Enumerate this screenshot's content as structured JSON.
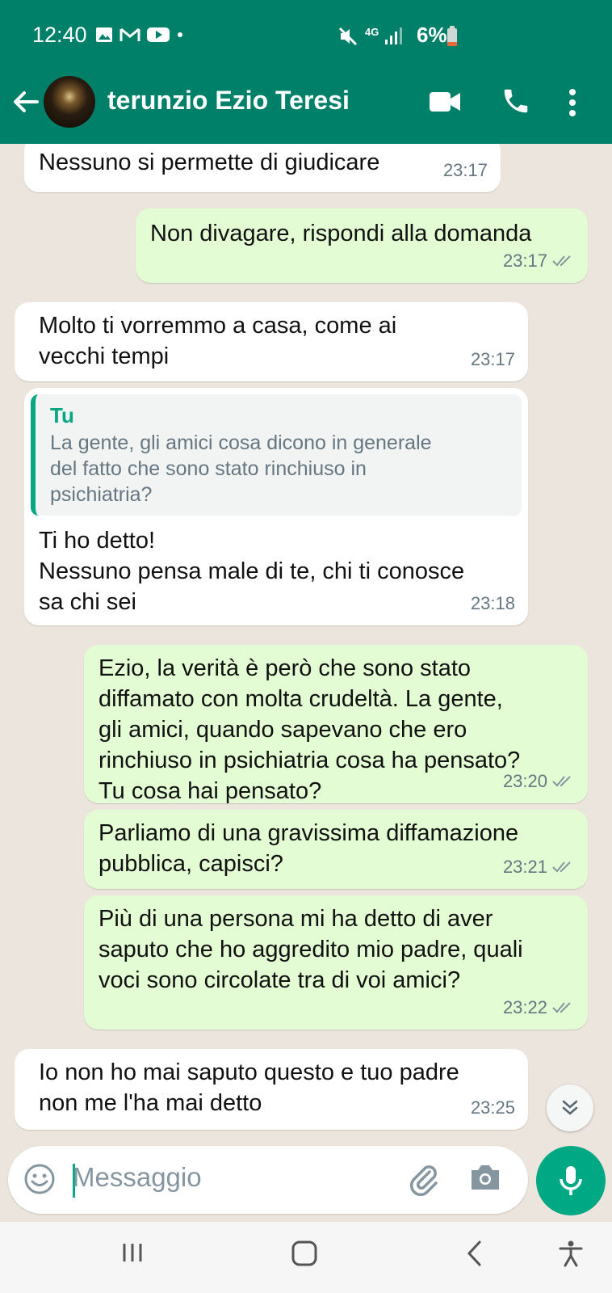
{
  "status": {
    "time": "12:40",
    "network": "4G",
    "battery": "6%"
  },
  "header": {
    "contact_name": "terunzio Ezio Teresi"
  },
  "colors": {
    "header_green": "#008069",
    "accent_green": "#00a884",
    "incoming_bubble": "#ffffff",
    "outgoing_bubble": "#e3fcd3",
    "chat_background": "#ece5dd"
  },
  "messages": [
    {
      "direction": "in",
      "text": "Nessuno si permette di giudicare",
      "time": "23:17"
    },
    {
      "direction": "out",
      "text": "Non divagare, rispondi alla domanda",
      "time": "23:17",
      "status": "read"
    },
    {
      "direction": "in",
      "text": "Molto ti vorremmo a casa, come ai\nvecchi tempi",
      "time": "23:17"
    },
    {
      "direction": "in",
      "quote": {
        "author": "Tu",
        "text": "La gente, gli amici cosa dicono in generale\ndel fatto che sono stato rinchiuso in\npsichiatria?"
      },
      "text": "Ti ho detto!\nNessuno pensa male di te, chi ti conosce\nsa chi sei",
      "time": "23:18"
    },
    {
      "direction": "out",
      "text": "Ezio, la verità è però che sono stato\ndiffamato con molta crudeltà.  La gente,\ngli amici, quando sapevano che ero\nrinchiuso in psichiatria cosa ha pensato?\nTu cosa hai pensato?",
      "time": "23:20",
      "status": "read"
    },
    {
      "direction": "out",
      "text": "Parliamo di una gravissima diffamazione\npubblica, capisci?",
      "time": "23:21",
      "status": "read"
    },
    {
      "direction": "out",
      "text": "Più di una persona mi ha detto di aver\nsaputo che ho aggredito mio padre, quali\nvoci sono circolate tra di voi amici?",
      "time": "23:22",
      "status": "read"
    },
    {
      "direction": "in",
      "text": "Io non ho mai saputo questo e tuo padre\nnon me l'ha mai detto",
      "time": "23:25"
    }
  ],
  "composer": {
    "placeholder": "Messaggio"
  },
  "icons": {
    "back": "arrow-left-icon",
    "video": "video-camera-icon",
    "call": "phone-icon",
    "menu": "more-vert-icon",
    "emoji": "emoji-icon",
    "attach": "paperclip-icon",
    "camera": "camera-icon",
    "mic": "microphone-icon",
    "scroll": "double-chevron-down-icon"
  }
}
